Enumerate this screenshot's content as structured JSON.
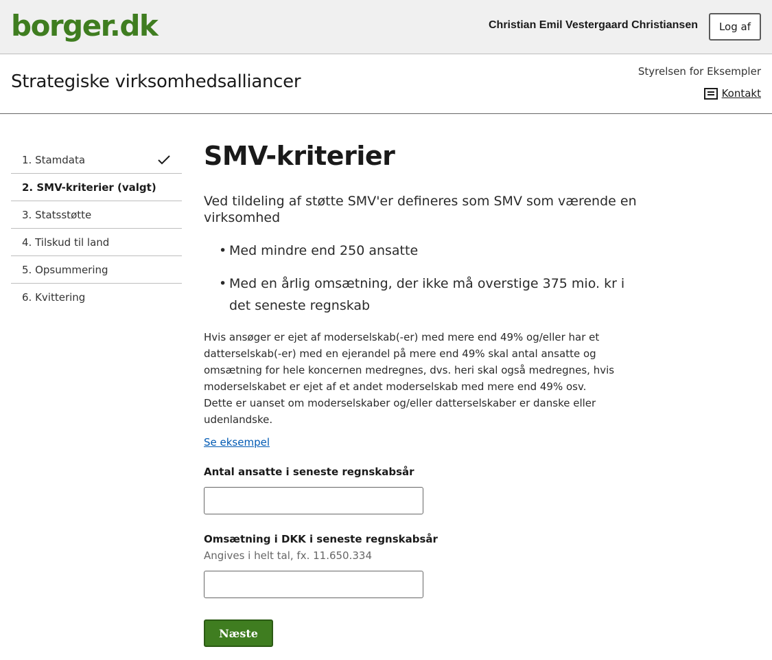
{
  "header": {
    "logo_text": "borger.dk",
    "user_name": "Christian Emil Vestergaard Christiansen",
    "logout_label": "Log af",
    "logo_color": "#3f7d20"
  },
  "service": {
    "title": "Strategiske virksomhedsalliancer",
    "authority": "Styrelsen for Eksempler",
    "contact_label": "Kontakt",
    "contact_icon": "message-icon"
  },
  "nav": {
    "items": [
      {
        "label": "1. Stamdata",
        "completed": true,
        "active": false
      },
      {
        "label": "2. SMV-kriterier (valgt)",
        "completed": false,
        "active": true
      },
      {
        "label": "3. Statsstøtte",
        "completed": false,
        "active": false
      },
      {
        "label": "4. Tilskud til land",
        "completed": false,
        "active": false
      },
      {
        "label": "5. Opsummering",
        "completed": false,
        "active": false
      },
      {
        "label": "6. Kvittering",
        "completed": false,
        "active": false
      }
    ]
  },
  "main": {
    "title": "SMV-kriterier",
    "lead": "Ved tildeling af støtte SMV'er defineres som SMV som værende en virksomhed",
    "bullets": [
      "Med mindre end 250 ansatte",
      "Med en årlig omsætning, der ikke må overstige 375 mio. kr i det seneste regnskab"
    ],
    "paragraph_1": "Hvis ansøger er ejet af moderselskab(-er) med mere end 49% og/eller har et datterselskab(-er) med en ejerandel på mere end 49% skal antal ansatte og omsætning for hele koncernen medregnes, dvs. heri skal også medregnes, hvis moderselskabet er ejet af et andet moderselskab med mere end 49% osv.",
    "paragraph_2": "Dette er uanset om moderselskaber og/eller datterselskaber er danske eller udenlandske.",
    "example_link": "Se eksempel",
    "field_employees": {
      "label": "Antal ansatte i seneste regnskabsår",
      "value": ""
    },
    "field_revenue": {
      "label": "Omsætning i DKK i seneste regnskabsår",
      "hint": "Angives i helt tal, fx. 11.650.334",
      "value": ""
    },
    "next_label": "Næste",
    "button_color": "#3f7d20"
  }
}
